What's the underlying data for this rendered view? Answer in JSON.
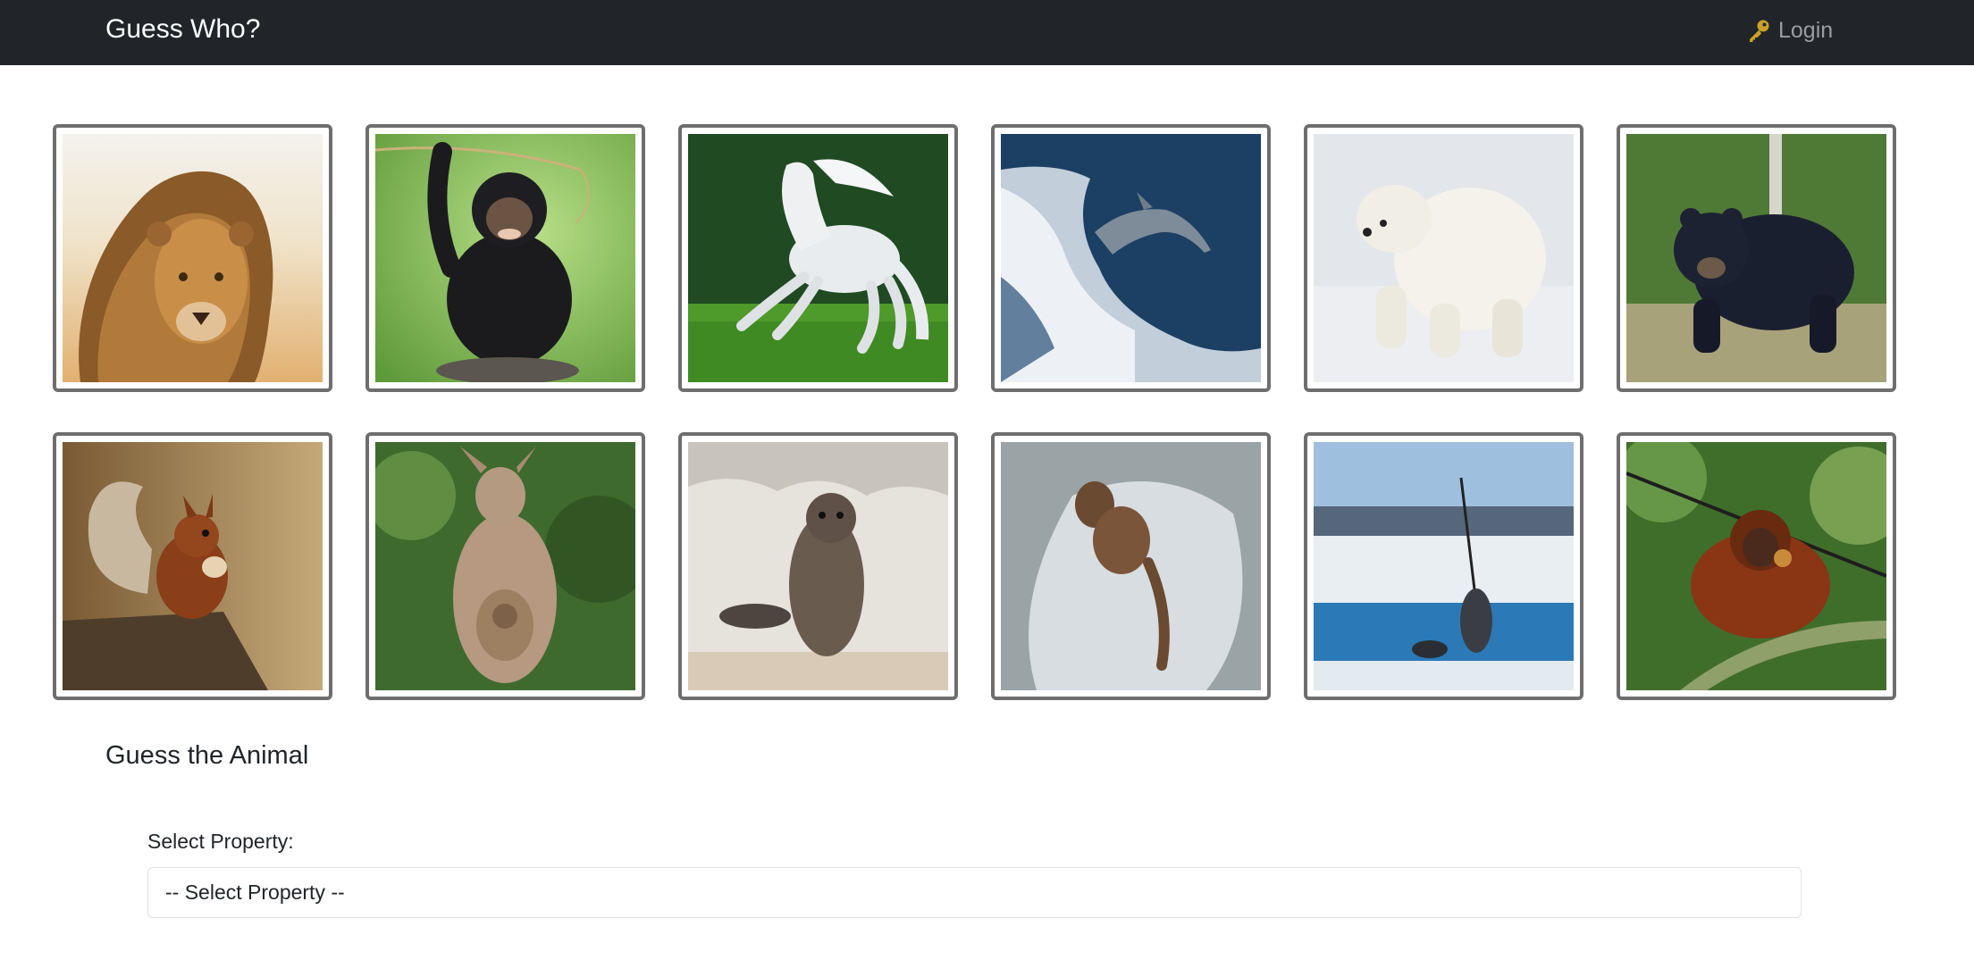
{
  "navbar": {
    "brand": "Guess Who?",
    "login_label": "Login",
    "login_icon": "key-icon",
    "background": "#212529"
  },
  "cards": [
    {
      "animal": "lion"
    },
    {
      "animal": "chimpanzee"
    },
    {
      "animal": "horse"
    },
    {
      "animal": "dolphin"
    },
    {
      "animal": "polar-bear"
    },
    {
      "animal": "black-bear"
    },
    {
      "animal": "squirrel"
    },
    {
      "animal": "kangaroo"
    },
    {
      "animal": "seal"
    },
    {
      "animal": "otter"
    },
    {
      "animal": "narwhal"
    },
    {
      "animal": "orangutan"
    }
  ],
  "guess_section": {
    "title": "Guess the Animal",
    "property_label": "Select Property:",
    "property_select": {
      "selected": "-- Select Property --"
    }
  },
  "colors": {
    "card_border": "#6e6e6e",
    "key_icon": "#c9a227"
  }
}
